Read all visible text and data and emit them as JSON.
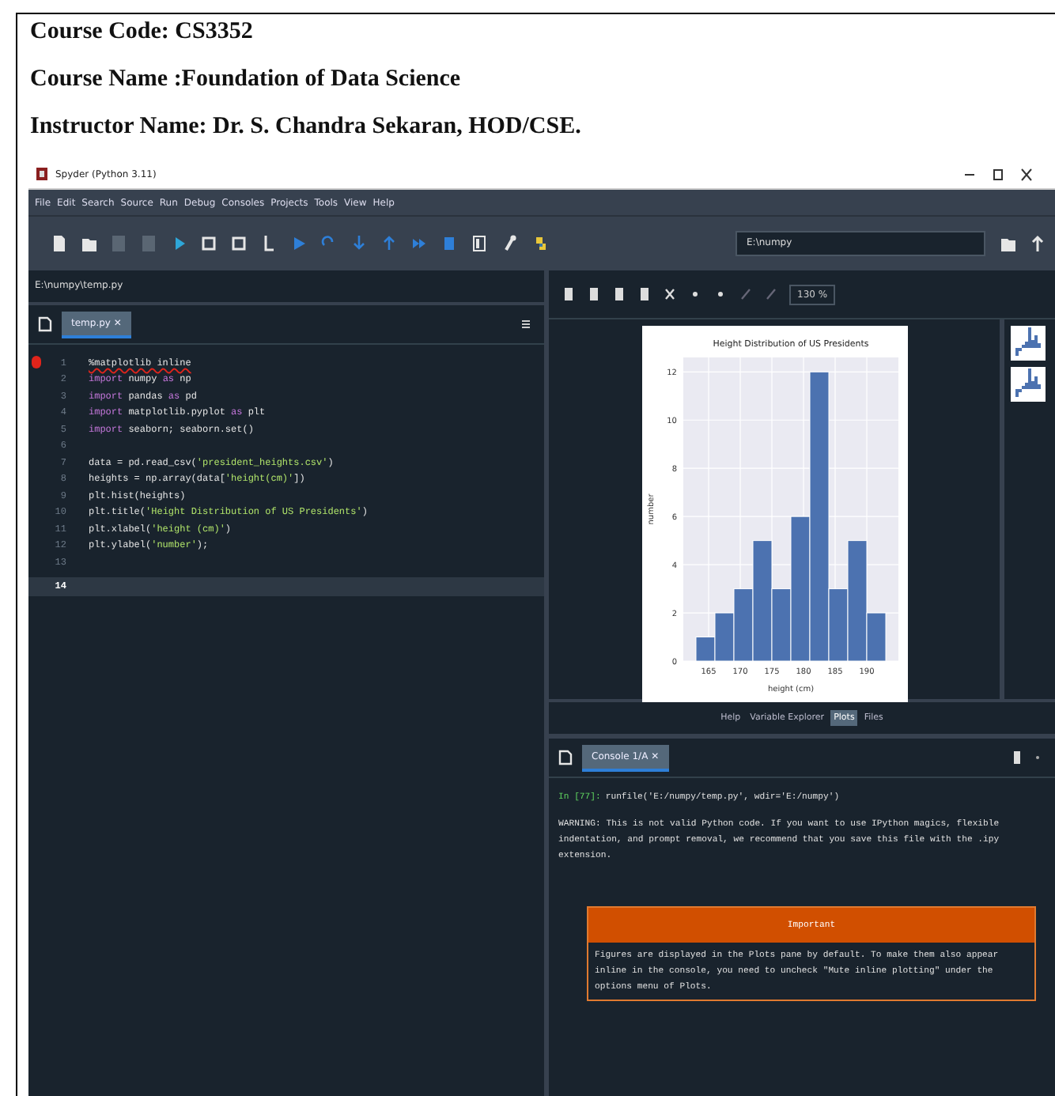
{
  "document": {
    "lines": [
      "Course Code: CS3352",
      "Course Name :Foundation of Data Science",
      "Instructor Name: Dr. S. Chandra Sekaran, HOD/CSE."
    ]
  },
  "window": {
    "title": "Spyder (Python 3.11)"
  },
  "menu": [
    "File",
    "Edit",
    "Search",
    "Source",
    "Run",
    "Debug",
    "Consoles",
    "Projects",
    "Tools",
    "View",
    "Help"
  ],
  "toolbar": {
    "working_directory": "E:\\numpy"
  },
  "editor": {
    "path": "E:\\numpy\\temp.py",
    "tabs": [
      {
        "label": "temp.py ✕",
        "selected": true
      }
    ],
    "lines": [
      {
        "number": "1",
        "error": true,
        "current": false,
        "tokens": [
          {
            "kind": "plain",
            "text": "%matplotlib inline"
          }
        ]
      },
      {
        "number": "2",
        "error": false,
        "current": false,
        "tokens": [
          {
            "kind": "keyword",
            "text": "import"
          },
          {
            "kind": "plain",
            "text": " numpy "
          },
          {
            "kind": "keyword",
            "text": "as"
          },
          {
            "kind": "plain",
            "text": " np"
          }
        ]
      },
      {
        "number": "3",
        "error": false,
        "current": false,
        "tokens": [
          {
            "kind": "keyword",
            "text": "import"
          },
          {
            "kind": "plain",
            "text": " pandas "
          },
          {
            "kind": "keyword",
            "text": "as"
          },
          {
            "kind": "plain",
            "text": " pd"
          }
        ]
      },
      {
        "number": "4",
        "error": false,
        "current": false,
        "tokens": [
          {
            "kind": "keyword",
            "text": "import"
          },
          {
            "kind": "plain",
            "text": " matplotlib.pyplot "
          },
          {
            "kind": "keyword",
            "text": "as"
          },
          {
            "kind": "plain",
            "text": " plt"
          }
        ]
      },
      {
        "number": "5",
        "error": false,
        "current": false,
        "tokens": [
          {
            "kind": "keyword",
            "text": "import"
          },
          {
            "kind": "plain",
            "text": " seaborn; seaborn.set()"
          }
        ]
      },
      {
        "number": "6",
        "error": false,
        "current": false
      },
      {
        "number": "7",
        "error": false,
        "current": false,
        "tokens": [
          {
            "kind": "plain",
            "text": "data = pd.read_csv("
          },
          {
            "kind": "string",
            "text": "'president_heights.csv'"
          },
          {
            "kind": "plain",
            "text": ")"
          }
        ]
      },
      {
        "number": "8",
        "error": false,
        "current": false,
        "tokens": [
          {
            "kind": "plain",
            "text": "heights = np.array(data["
          },
          {
            "kind": "string",
            "text": "'height(cm)'"
          },
          {
            "kind": "plain",
            "text": "])"
          }
        ]
      },
      {
        "number": "9",
        "error": false,
        "current": false,
        "tokens": [
          {
            "kind": "plain",
            "text": "plt.hist(heights)"
          }
        ]
      },
      {
        "number": "10",
        "error": false,
        "current": false,
        "tokens": [
          {
            "kind": "plain",
            "text": "plt.title("
          },
          {
            "kind": "string",
            "text": "'Height Distribution of US Presidents'"
          },
          {
            "kind": "plain",
            "text": ")"
          }
        ]
      },
      {
        "number": "11",
        "error": false,
        "current": false,
        "tokens": [
          {
            "kind": "plain",
            "text": "plt.xlabel("
          },
          {
            "kind": "string",
            "text": "'height (cm)'"
          },
          {
            "kind": "plain",
            "text": ")"
          }
        ]
      },
      {
        "number": "12",
        "error": false,
        "current": false,
        "tokens": [
          {
            "kind": "plain",
            "text": "plt.ylabel("
          },
          {
            "kind": "string",
            "text": "'number'"
          },
          {
            "kind": "plain",
            "text": ");"
          }
        ]
      },
      {
        "number": "13",
        "error": false,
        "current": false
      },
      {
        "number": "14",
        "error": false,
        "current": true
      }
    ]
  },
  "plots": {
    "zoom": "130 %",
    "chart_data": {
      "type": "bar",
      "title": "Height Distribution of US Presidents",
      "xlabel": "height (cm)",
      "ylabel": "number",
      "x": [
        164.5,
        167.5,
        170.5,
        173.5,
        176.5,
        179.5,
        182.5,
        185.5,
        188.5,
        191.5
      ],
      "values": [
        1,
        2,
        3,
        5,
        3,
        6,
        12,
        3,
        5,
        2
      ],
      "xlim": [
        161,
        195
      ],
      "ylim": [
        0,
        12.6
      ],
      "xticks": [
        165,
        170,
        175,
        180,
        185,
        190
      ],
      "yticks": [
        0,
        2,
        4,
        6,
        8,
        10,
        12
      ],
      "grid": true
    }
  },
  "pane_tabs": [
    {
      "label": "Help",
      "selected": false
    },
    {
      "label": "Variable Explorer",
      "selected": false
    },
    {
      "label": "Plots",
      "selected": true
    },
    {
      "label": "Files",
      "selected": false
    }
  ],
  "console": {
    "tabs": [
      {
        "label": "Console 1/A ✕",
        "selected": true
      }
    ],
    "prompt": "In [77]:",
    "command": "runfile('E:/numpy/temp.py', wdir='E:/numpy')",
    "warning": "WARNING: This is not valid Python code. If you want to use IPython magics, flexible indentation, and prompt removal, we recommend that you save this file with the .ipy extension.",
    "notice": {
      "title": "Important",
      "text": "Figures are displayed in the Plots pane by default. To make them also appear inline in the console, you need to uncheck \"Mute inline plotting\" under the options menu of Plots."
    }
  }
}
